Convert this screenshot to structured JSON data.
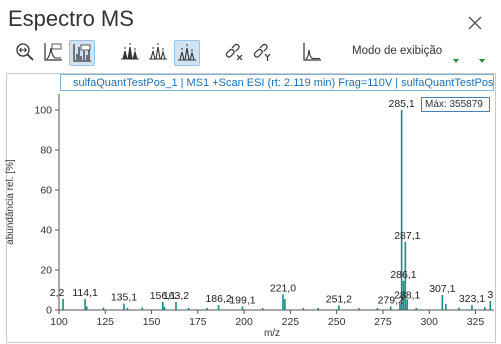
{
  "window": {
    "title": "Espectro MS"
  },
  "toolbar": {
    "mode_label": "Modo de exibição",
    "buttons": [
      {
        "name": "zoom-fit-button",
        "icon": "zoom-out-icon",
        "active": false
      },
      {
        "name": "line-spectrum-button",
        "icon": "line-spectrum-icon",
        "active": false
      },
      {
        "name": "bar-spectrum-button",
        "icon": "bar-spectrum-icon",
        "active": true
      },
      {
        "name": "peak-labels-1-button",
        "icon": "peak-labels-icon",
        "active": false
      },
      {
        "name": "peak-labels-2-button",
        "icon": "peak-labels-icon",
        "active": false
      },
      {
        "name": "peak-labels-3-button",
        "icon": "peak-labels-icon",
        "active": true
      },
      {
        "name": "unlink-x-button",
        "icon": "unlink-x-icon",
        "active": false
      },
      {
        "name": "unlink-y-button",
        "icon": "unlink-y-icon",
        "active": false
      },
      {
        "name": "profile-button",
        "icon": "profile-icon",
        "active": false
      }
    ],
    "accent": "#2e8b3e"
  },
  "header": {
    "text": "sulfaQuantTestPos_1 | MS1 +Scan ESI (rt: 2.119 min) Frag=110V | sulfaQuantTestPos_"
  },
  "tooltip": {
    "text": "Máx: 355879"
  },
  "chart_data": {
    "type": "bar",
    "xlabel": "m/z",
    "ylabel": "abundância rel. [%]",
    "xlim": [
      100,
      335
    ],
    "ylim": [
      0,
      108
    ],
    "xticks": [
      100,
      125,
      150,
      175,
      200,
      225,
      250,
      275,
      300,
      325
    ],
    "yticks": [
      0,
      20,
      40,
      60,
      80,
      100
    ],
    "color": "#1a8a8a",
    "peaks": [
      {
        "x": 102.2,
        "y": 5.5,
        "label": "2,2"
      },
      {
        "x": 114.1,
        "y": 5.5,
        "label": "114,1"
      },
      {
        "x": 115.0,
        "y": 1.8,
        "label": ""
      },
      {
        "x": 124.0,
        "y": 1.2,
        "label": ""
      },
      {
        "x": 135.1,
        "y": 3.2,
        "label": "135,1"
      },
      {
        "x": 137.0,
        "y": 1.0,
        "label": ""
      },
      {
        "x": 145.0,
        "y": 1.2,
        "label": ""
      },
      {
        "x": 156.1,
        "y": 4.0,
        "label": "156,1"
      },
      {
        "x": 157.0,
        "y": 1.5,
        "label": ""
      },
      {
        "x": 163.2,
        "y": 4.0,
        "label": "163,2"
      },
      {
        "x": 170.0,
        "y": 1.0,
        "label": ""
      },
      {
        "x": 180.0,
        "y": 1.0,
        "label": ""
      },
      {
        "x": 186.2,
        "y": 2.5,
        "label": "186,2"
      },
      {
        "x": 199.1,
        "y": 1.8,
        "label": "199,1"
      },
      {
        "x": 210.0,
        "y": 1.0,
        "label": ""
      },
      {
        "x": 221.0,
        "y": 7.8,
        "label": "221,0"
      },
      {
        "x": 222.0,
        "y": 5.5,
        "label": ""
      },
      {
        "x": 232.0,
        "y": 1.0,
        "label": ""
      },
      {
        "x": 240.0,
        "y": 1.0,
        "label": ""
      },
      {
        "x": 251.2,
        "y": 2.3,
        "label": "251,2"
      },
      {
        "x": 262.0,
        "y": 1.0,
        "label": ""
      },
      {
        "x": 272.0,
        "y": 1.0,
        "label": ""
      },
      {
        "x": 279.2,
        "y": 1.8,
        "label": "279,2"
      },
      {
        "x": 284.2,
        "y": 3.0,
        "label": ""
      },
      {
        "x": 285.1,
        "y": 100.0,
        "label": "285,1"
      },
      {
        "x": 286.1,
        "y": 14.5,
        "label": "286,1"
      },
      {
        "x": 287.1,
        "y": 34.0,
        "label": "287,1"
      },
      {
        "x": 288.1,
        "y": 5.3,
        "label": "288,1"
      },
      {
        "x": 293.0,
        "y": 1.0,
        "label": ""
      },
      {
        "x": 307.1,
        "y": 7.5,
        "label": "307,1"
      },
      {
        "x": 309.0,
        "y": 3.0,
        "label": ""
      },
      {
        "x": 316.0,
        "y": 1.2,
        "label": ""
      },
      {
        "x": 323.1,
        "y": 2.5,
        "label": "323,1"
      },
      {
        "x": 330.0,
        "y": 1.5,
        "label": ""
      },
      {
        "x": 333.0,
        "y": 4.5,
        "label": "3"
      }
    ]
  }
}
